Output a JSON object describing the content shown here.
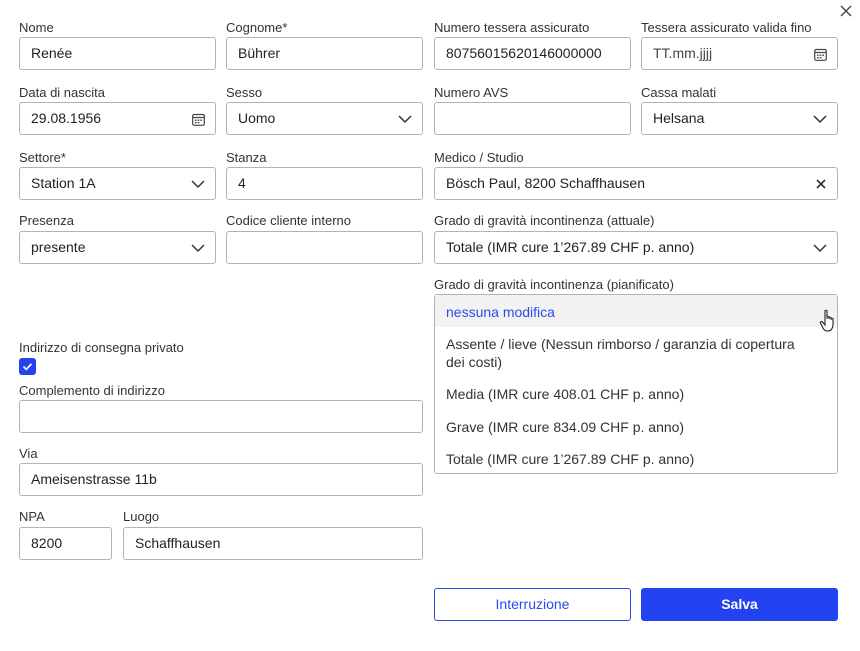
{
  "dialog": {
    "close_icon": "close-icon"
  },
  "fields": {
    "nome": {
      "label": "Nome",
      "value": "Renée"
    },
    "cognome": {
      "label": "Cognome*",
      "value": "Bührer"
    },
    "numero_tessera": {
      "label": "Numero tessera assicurato",
      "value": "80756015620146000000"
    },
    "tessera_valida": {
      "label": "Tessera assicurato valida fino",
      "placeholder": "TT.mm.jjjj"
    },
    "data_nascita": {
      "label": "Data di nascita",
      "value": "29.08.1956"
    },
    "sesso": {
      "label": "Sesso",
      "value": "Uomo"
    },
    "numero_avs": {
      "label": "Numero AVS",
      "value": ""
    },
    "cassa_malati": {
      "label": "Cassa malati",
      "value": "Helsana"
    },
    "settore": {
      "label": "Settore*",
      "value": "Station 1A"
    },
    "stanza": {
      "label": "Stanza",
      "value": "4"
    },
    "medico": {
      "label": "Medico / Studio",
      "value": "Bösch Paul, 8200 Schaffhausen"
    },
    "presenza": {
      "label": "Presenza",
      "value": "presente"
    },
    "codice_cliente": {
      "label": "Codice cliente interno",
      "value": ""
    },
    "grado_attuale": {
      "label": "Grado di gravità incontinenza (attuale)",
      "value": "Totale (IMR cure 1’267.89 CHF p. anno)"
    },
    "grado_pianificato": {
      "label": "Grado di gravità incontinenza (pianificato)"
    },
    "indirizzo_privato": {
      "label": "Indirizzo di consegna privato",
      "checked": true
    },
    "complemento": {
      "label": "Complemento di indirizzo",
      "value": ""
    },
    "via": {
      "label": "Via",
      "value": "Ameisenstrasse 11b"
    },
    "npa": {
      "label": "NPA",
      "value": "8200"
    },
    "luogo": {
      "label": "Luogo",
      "value": "Schaffhausen"
    }
  },
  "dropdown_options": [
    "nessuna modifica",
    "Assente / lieve (Nessun rimborso / garanzia di copertura dei costi)",
    "Media (IMR cure 408.01 CHF p. anno)",
    "Grave (IMR cure 834.09 CHF p. anno)",
    "Totale (IMR cure 1’267.89 CHF p. anno)"
  ],
  "colors": {
    "accent": "#2443f0",
    "highlight_text": "#2b4bef"
  },
  "buttons": {
    "cancel_label": "Interruzione",
    "save_label": "Salva"
  }
}
